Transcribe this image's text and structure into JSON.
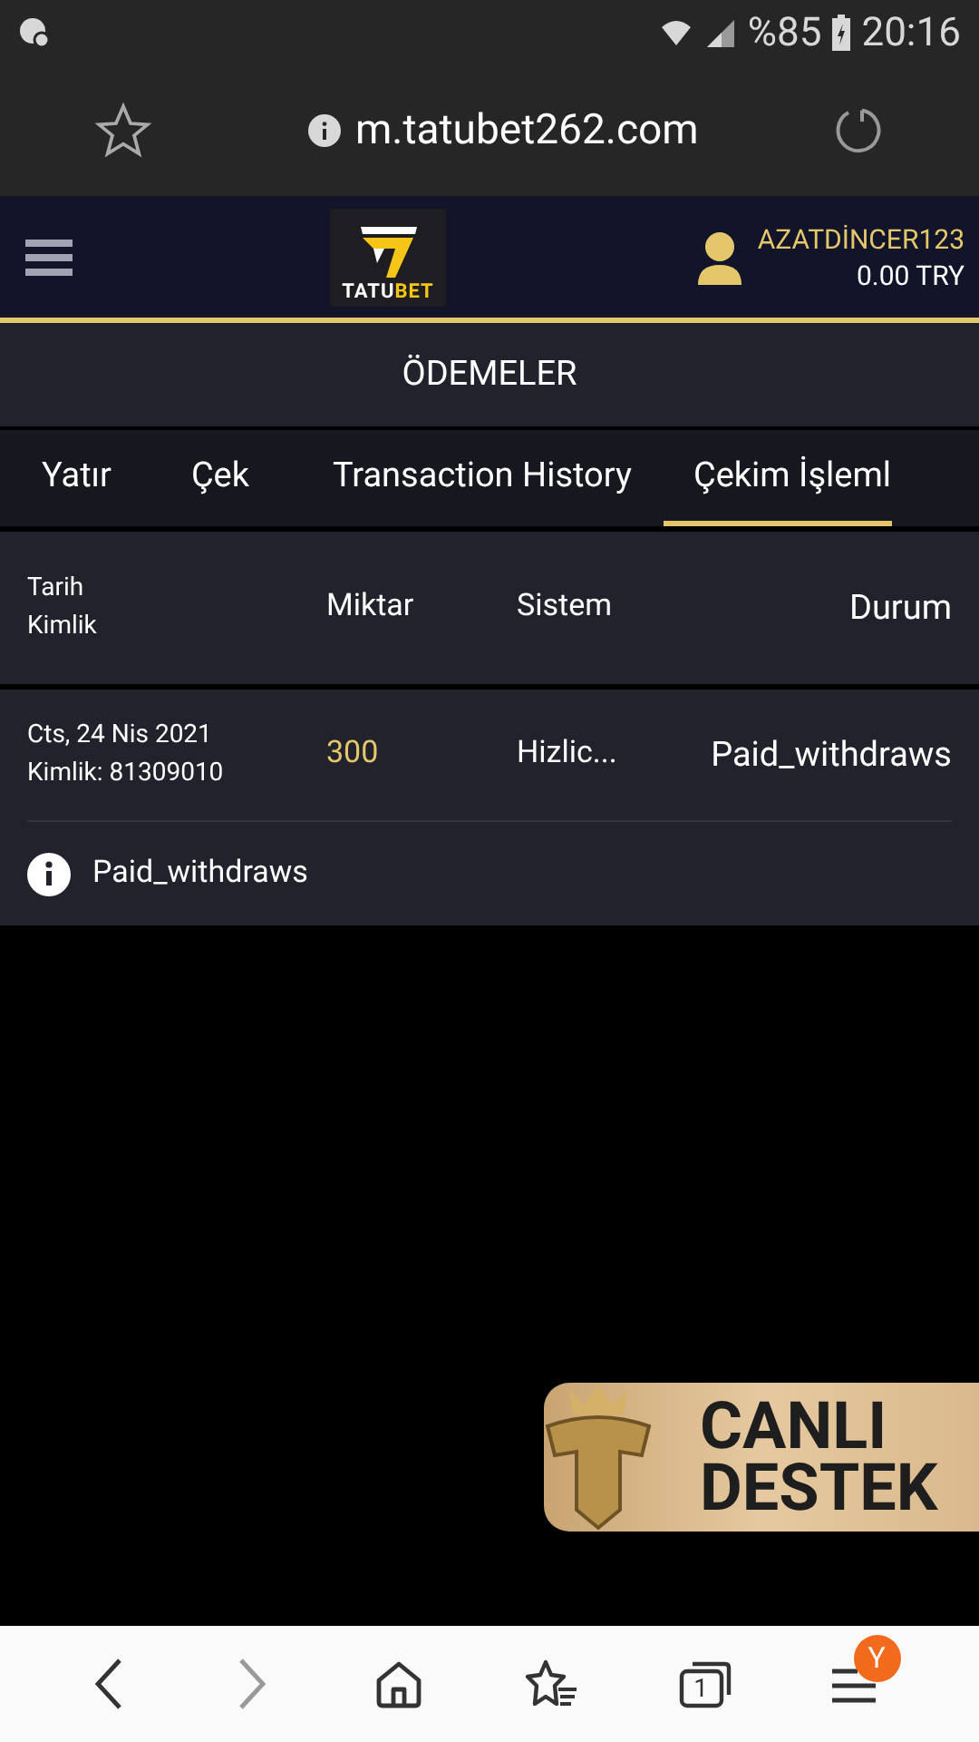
{
  "status_bar": {
    "battery": "%85",
    "time": "20:16"
  },
  "browser": {
    "url": "m.tatubet262.com"
  },
  "header": {
    "logo_text": [
      "TATU",
      "BET"
    ],
    "username": "AZATDİNCER123",
    "balance": "0.00 TRY"
  },
  "page_title": "ÖDEMELER",
  "tabs": [
    {
      "label": "Yatır",
      "selected": false
    },
    {
      "label": "Çek",
      "selected": false
    },
    {
      "label": "Transaction History",
      "selected": false
    },
    {
      "label": "Çekim İşleml",
      "selected": true
    }
  ],
  "table": {
    "columns": [
      {
        "lines": [
          "Tarih",
          "Kimlik"
        ]
      },
      {
        "lines": [
          "Miktar"
        ]
      },
      {
        "lines": [
          "Sistem"
        ]
      },
      {
        "lines": [
          "Durum"
        ]
      }
    ],
    "rows": [
      {
        "date": "Cts, 24 Nis 2021",
        "id": "Kimlik: 81309010",
        "amount": "300",
        "system": "Hizlic...",
        "status": "Paid_withdraws",
        "note": "Paid_withdraws"
      }
    ]
  },
  "support_button": {
    "lines": [
      "CANLI",
      "DESTEK"
    ]
  },
  "bottom_nav": {
    "back_disabled": false,
    "forward_disabled": true,
    "tab_count": "1",
    "badge": "Y"
  }
}
